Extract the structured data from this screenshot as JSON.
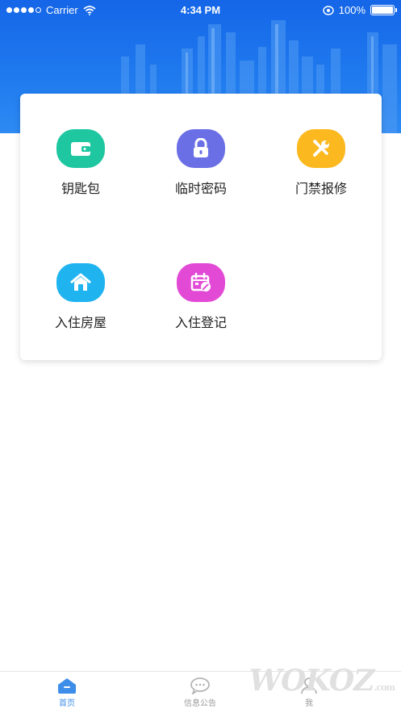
{
  "status_bar": {
    "carrier": "Carrier",
    "time": "4:34 PM",
    "battery": "100%",
    "icons": [
      "signal-dots-icon",
      "wifi-icon",
      "location-icon",
      "battery-icon"
    ]
  },
  "colors": {
    "header_blue": "#1f79ee",
    "wallet": "#1fc7a1",
    "password": "#6b6fe6",
    "repair": "#fbb81f",
    "house": "#1fb4f0",
    "checkin": "#e24ad6",
    "tab_active": "#3d8ee8",
    "tab_inactive": "#b5b5b5"
  },
  "grid": {
    "items": [
      {
        "label": "钥匙包",
        "icon": "wallet-icon"
      },
      {
        "label": "临时密码",
        "icon": "lock-icon"
      },
      {
        "label": "门禁报修",
        "icon": "repair-tools-icon"
      },
      {
        "label": "入住房屋",
        "icon": "house-icon"
      },
      {
        "label": "入住登记",
        "icon": "calendar-edit-icon"
      }
    ]
  },
  "tabbar": {
    "tabs": [
      {
        "label": "首页",
        "icon": "home-icon",
        "active": true
      },
      {
        "label": "信息公告",
        "icon": "chat-bubble-icon",
        "active": false
      },
      {
        "label": "我",
        "icon": "user-icon",
        "active": false
      }
    ]
  },
  "watermark": {
    "text": "WOKOZ",
    "suffix": ".com"
  }
}
